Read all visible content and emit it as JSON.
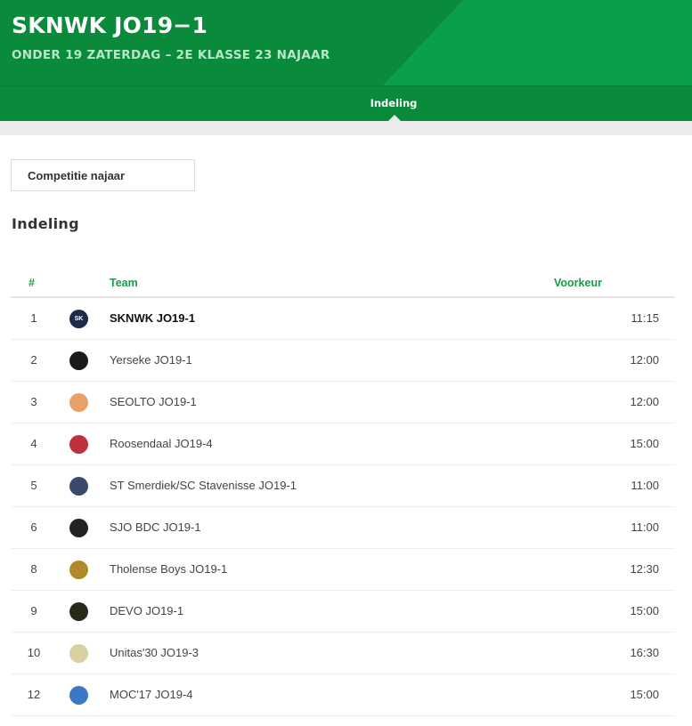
{
  "header": {
    "title": "SKNWK JO19−1",
    "subtitle": "ONDER 19 ZATERDAG – 2E KLASSE 23 NAJAAR"
  },
  "tabs": [
    {
      "label": "Indeling",
      "active": true
    }
  ],
  "competition_select": {
    "value": "Competitie najaar"
  },
  "section_title": "Indeling",
  "table": {
    "columns": {
      "position": "#",
      "team": "Team",
      "preference": "Voorkeur"
    },
    "rows": [
      {
        "position": "1",
        "team": "SKNWK JO19-1",
        "time": "11:15",
        "highlight": true,
        "logo_icon": "sknwk-logo-icon",
        "logo_color": "#1f2a4a",
        "logo_text": "SK"
      },
      {
        "position": "2",
        "team": "Yerseke JO19-1",
        "time": "12:00",
        "highlight": false,
        "logo_icon": "yerseke-logo-icon",
        "logo_color": "#1a1a1a"
      },
      {
        "position": "3",
        "team": "SEOLTO JO19-1",
        "time": "12:00",
        "highlight": false,
        "logo_icon": "seolto-logo-icon",
        "logo_color": "#e8a06a"
      },
      {
        "position": "4",
        "team": "Roosendaal JO19-4",
        "time": "15:00",
        "highlight": false,
        "logo_icon": "roosendaal-logo-icon",
        "logo_color": "#c0303a"
      },
      {
        "position": "5",
        "team": "ST Smerdiek/SC Stavenisse JO19-1",
        "time": "11:00",
        "highlight": false,
        "logo_icon": "smerdiek-logo-icon",
        "logo_color": "#3a4a6a"
      },
      {
        "position": "6",
        "team": "SJO BDC JO19-1",
        "time": "11:00",
        "highlight": false,
        "logo_icon": "bdc-logo-icon",
        "logo_color": "#222222"
      },
      {
        "position": "8",
        "team": "Tholense Boys JO19-1",
        "time": "12:30",
        "highlight": false,
        "logo_icon": "tholense-logo-icon",
        "logo_color": "#b08a2a"
      },
      {
        "position": "9",
        "team": "DEVO JO19-1",
        "time": "15:00",
        "highlight": false,
        "logo_icon": "devo-logo-icon",
        "logo_color": "#2a2a1a"
      },
      {
        "position": "10",
        "team": "Unitas'30 JO19-3",
        "time": "16:30",
        "highlight": false,
        "logo_icon": "unitas-logo-icon",
        "logo_color": "#d8d0a0"
      },
      {
        "position": "12",
        "team": "MOC'17 JO19-4",
        "time": "15:00",
        "highlight": false,
        "logo_icon": "moc-logo-icon",
        "logo_color": "#3a78c8"
      }
    ]
  }
}
